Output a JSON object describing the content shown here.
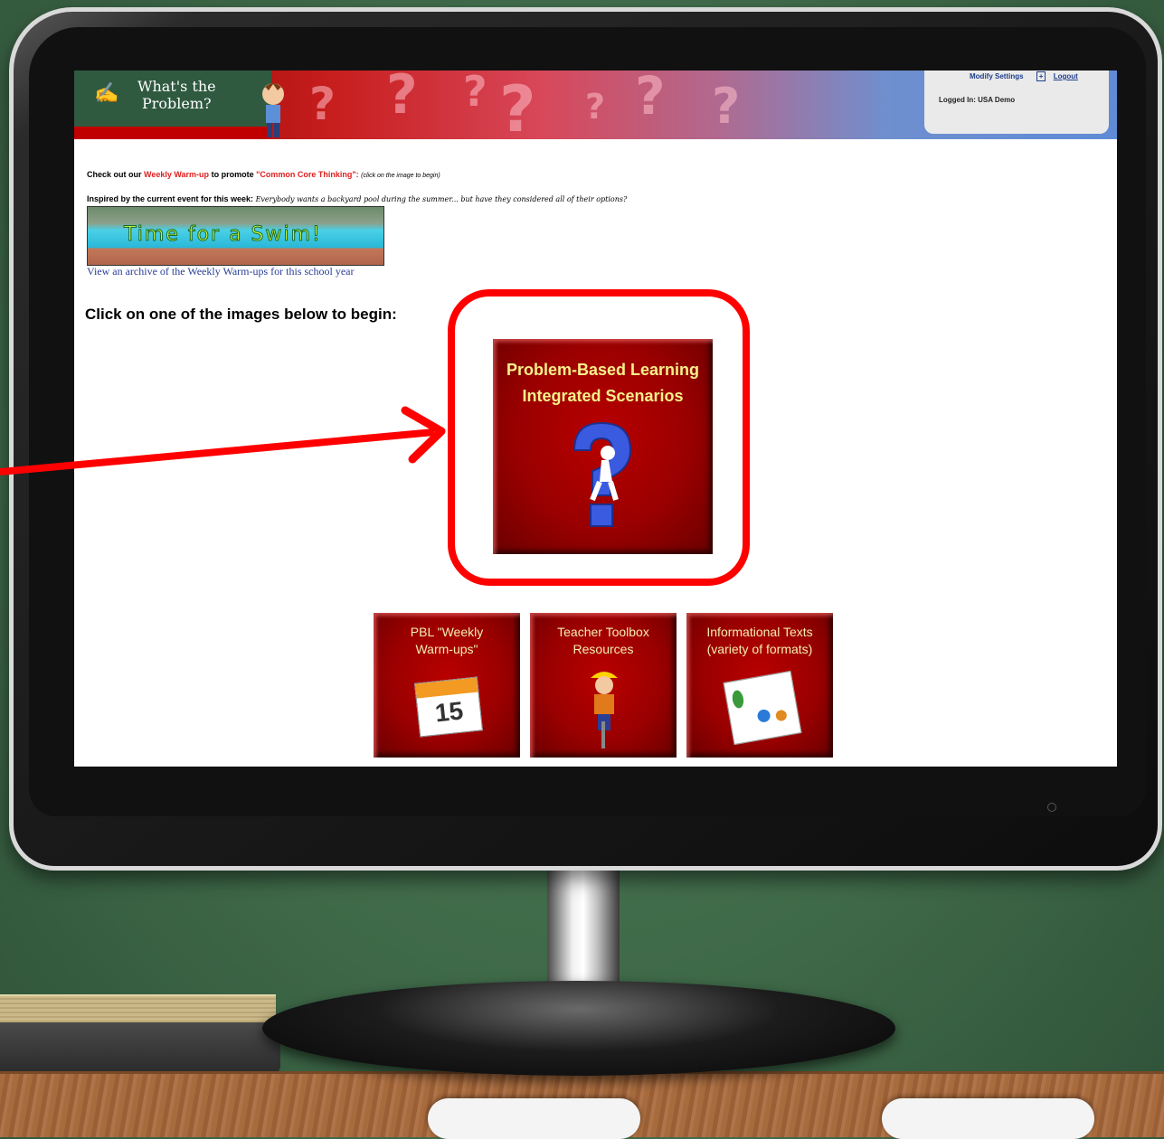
{
  "site": {
    "logo_line1": "What's the",
    "logo_line2": "Problem?",
    "account": {
      "modify_settings": "Modify Settings",
      "logout": "Logout",
      "logged_in": "Logged In: USA Demo"
    }
  },
  "intro": {
    "check_prefix": "Check out our",
    "weekly_warmup": "Weekly Warm-up",
    "to_promote": "to promote",
    "common_core": "\"Common Core Thinking\":",
    "click_hint": "(click on the image to begin)",
    "inspired_label": "Inspired by the current event for this week:",
    "inspired_text": "Everybody wants a backyard pool during the summer... but have they considered all of their options?",
    "banner_title": "Time for a Swim!",
    "archive_link": "View an archive of the Weekly Warm-ups for this school year"
  },
  "main": {
    "click_begin": "Click on one of the images below to begin:",
    "pbl_tile_line1": "Problem-Based Learning",
    "pbl_tile_line2": "Integrated Scenarios"
  },
  "tiles": {
    "warmups_line1": "PBL \"Weekly",
    "warmups_line2": "Warm-ups\"",
    "calendar_day": "15",
    "toolbox_line1": "Teacher Toolbox",
    "toolbox_line2": "Resources",
    "texts_line1": "Informational Texts",
    "texts_line2": "(variety of formats)"
  },
  "colors": {
    "highlight": "#ff0000",
    "tile_red": "#9a0000",
    "tile_text": "#f6f08a",
    "link_blue": "#2a3e96"
  }
}
